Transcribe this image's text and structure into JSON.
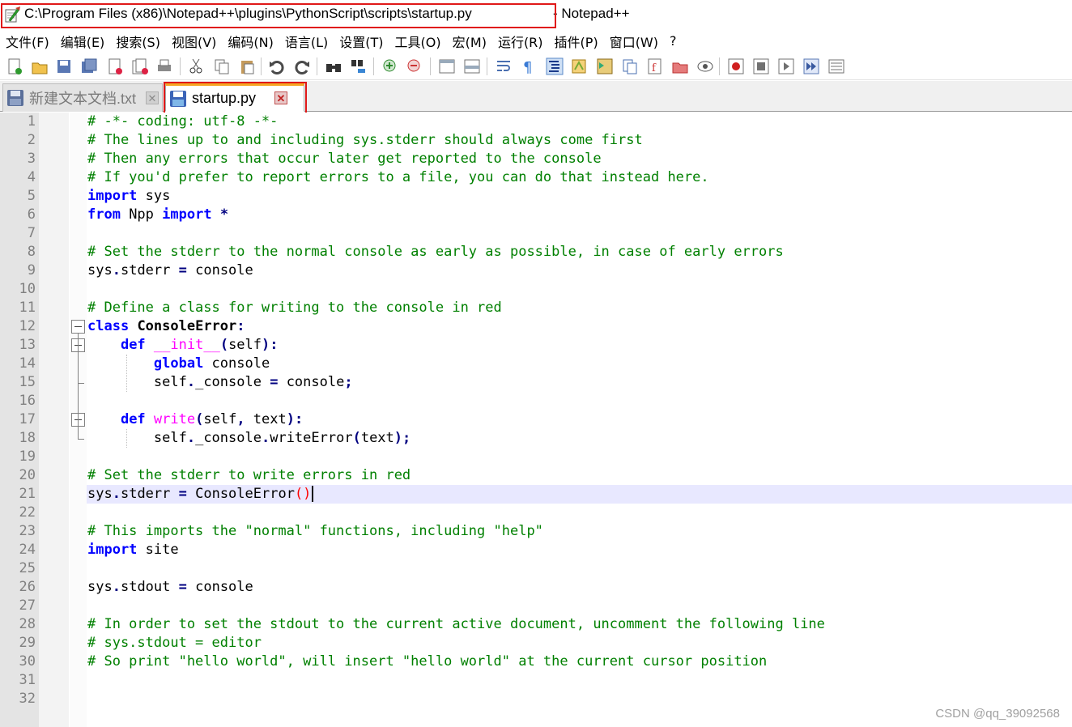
{
  "window": {
    "path": "C:\\Program Files (x86)\\Notepad++\\plugins\\PythonScript\\scripts\\startup.py",
    "suffix": "- Notepad++"
  },
  "menu": [
    "文件(F)",
    "编辑(E)",
    "搜索(S)",
    "视图(V)",
    "编码(N)",
    "语言(L)",
    "设置(T)",
    "工具(O)",
    "宏(M)",
    "运行(R)",
    "插件(P)",
    "窗口(W)",
    "?"
  ],
  "tabs": [
    {
      "label": "新建文本文档.txt",
      "active": false
    },
    {
      "label": "startup.py",
      "active": true
    }
  ],
  "toolbar_icons": [
    "new-file-icon",
    "open-file-icon",
    "save-icon",
    "save-all-icon",
    "close-icon",
    "close-all-icon",
    "print-icon",
    "cut-icon",
    "copy-icon",
    "paste-icon",
    "undo-icon",
    "redo-icon",
    "find-icon",
    "replace-icon",
    "zoom-in-icon",
    "zoom-out-icon",
    "sync-vertical-icon",
    "sync-horizontal-icon",
    "word-wrap-icon",
    "show-all-characters-icon",
    "indent-guide-icon",
    "user-language-icon",
    "document-map-icon",
    "document-list-icon",
    "function-list-icon",
    "folder-as-workspace-icon",
    "monitoring-icon",
    "record-macro-icon",
    "stop-record-icon",
    "play-macro-icon",
    "run-macro-multiple-icon",
    "save-macro-icon"
  ],
  "code_lines": [
    "# -*- coding: utf-8 -*-",
    "# The lines up to and including sys.stderr should always come first",
    "# Then any errors that occur later get reported to the console",
    "# If you'd prefer to report errors to a file, you can do that instead here.",
    "import sys",
    "from Npp import *",
    "",
    "# Set the stderr to the normal console as early as possible, in case of early errors",
    "sys.stderr = console",
    "",
    "# Define a class for writing to the console in red",
    "class ConsoleError:",
    "    def __init__(self):",
    "        global console",
    "        self._console = console;",
    "",
    "    def write(self, text):",
    "        self._console.writeError(text);",
    "",
    "# Set the stderr to write errors in red",
    "sys.stderr = ConsoleError()",
    "",
    "# This imports the \"normal\" functions, including \"help\"",
    "import site",
    "",
    "sys.stdout = console",
    "",
    "# In order to set the stdout to the current active document, uncomment the following line",
    "# sys.stdout = editor",
    "# So print \"hello world\", will insert \"hello world\" at the current cursor position",
    "",
    ""
  ],
  "current_line": 21,
  "watermark": "CSDN @qq_39092568",
  "colors": {
    "comment": "#008000",
    "keyword": "#0000ff",
    "highlight_box": "#e01818",
    "current_line_bg": "#e8e8ff"
  }
}
